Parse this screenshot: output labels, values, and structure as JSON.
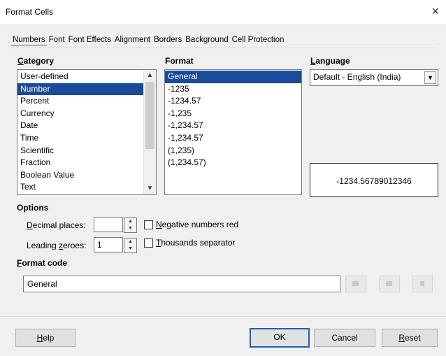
{
  "window": {
    "title": "Format Cells",
    "close_glyph": "×"
  },
  "tabs": [
    {
      "label": "Numbers",
      "active": true
    },
    {
      "label": "Font"
    },
    {
      "label": "Font Effects"
    },
    {
      "label": "Alignment"
    },
    {
      "label": "Borders"
    },
    {
      "label": "Background"
    },
    {
      "label": "Cell Protection"
    }
  ],
  "category": {
    "heading": "Category",
    "items": [
      "User-defined",
      "Number",
      "Percent",
      "Currency",
      "Date",
      "Time",
      "Scientific",
      "Fraction",
      "Boolean Value",
      "Text"
    ],
    "selected_index": 1
  },
  "format": {
    "heading": "Format",
    "items": [
      "General",
      "-1235",
      "-1234.57",
      "-1,235",
      "-1,234.57",
      "-1,234.57",
      "(1,235)",
      "(1,234.57)"
    ],
    "selected_index": 0
  },
  "language": {
    "heading": "Language",
    "value": "Default - English (India)"
  },
  "preview": {
    "text": "-1234.56789012346"
  },
  "options": {
    "heading": "Options",
    "decimal_places_label": "Decimal places:",
    "decimal_places_value": "",
    "leading_zeroes_label": "Leading zeroes:",
    "leading_zeroes_value": "1",
    "negative_red_label": "Negative numbers red",
    "negative_red_checked": false,
    "thousands_sep_label": "Thousands separator",
    "thousands_sep_checked": false
  },
  "format_code": {
    "heading": "Format code",
    "value": "General"
  },
  "buttons": {
    "help": "Help",
    "ok": "OK",
    "cancel": "Cancel",
    "reset": "Reset"
  },
  "icons": [
    "close-icon",
    "scroll-up-icon",
    "scroll-down-icon",
    "dropdown-arrow-icon",
    "spin-up-icon",
    "spin-down-icon",
    "add-icon",
    "delete-icon",
    "edit-comment-icon"
  ]
}
